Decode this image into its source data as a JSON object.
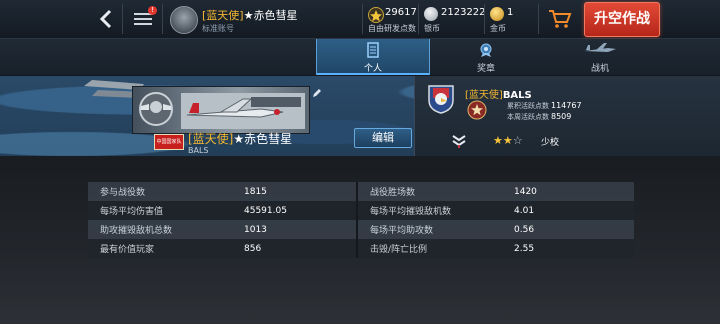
{
  "top_bar": {
    "player_tag": "[蓝天使]",
    "player_name": "★赤色彗星",
    "account_label": "标准账号",
    "menu_badge": "!",
    "resources": [
      {
        "icon": "star-icon",
        "value": "29617",
        "label": "自由研发点数"
      },
      {
        "icon": "silver-coin-icon",
        "value": "2123222",
        "label": "银币"
      },
      {
        "icon": "gold-coin-icon",
        "value": "1",
        "label": "金币"
      }
    ],
    "takeoff_label": "升空作战"
  },
  "tabs": [
    {
      "label": "个人",
      "icon": "personal-doc-icon",
      "active": true
    },
    {
      "label": "奖章",
      "icon": "medal-icon",
      "active": false
    },
    {
      "label": "战机",
      "icon": "plane-icon",
      "active": false
    }
  ],
  "profile": {
    "flag_text": "中国国家队",
    "name_tag": "[蓝天使]",
    "name": "★赤色彗星",
    "clan_short": "BALS",
    "edit_label": "编辑"
  },
  "clan": {
    "tag": "[蓝天使]",
    "name": "BALS",
    "total_activity_label": "累积活跃点数",
    "total_activity_value": "114767",
    "weekly_activity_label": "本周活跃点数",
    "weekly_activity_value": "8509",
    "stars_filled": 2,
    "stars_total": 3,
    "rank_label": "少校"
  },
  "stats": {
    "rows": [
      {
        "left_label": "参与战役数",
        "left_value": "1815",
        "right_label": "战役胜场数",
        "right_value": "1420"
      },
      {
        "left_label": "每场平均伤害值",
        "left_value": "45591.05",
        "right_label": "每场平均摧毁敌机数",
        "right_value": "4.01"
      },
      {
        "left_label": "助攻摧毁敌机总数",
        "left_value": "1013",
        "right_label": "每场平均助攻数",
        "right_value": "0.56"
      },
      {
        "left_label": "最有价值玩家",
        "left_value": "856",
        "right_label": "击毁/阵亡比例",
        "right_value": "2.55"
      }
    ]
  },
  "colors": {
    "accent_gold": "#f2b632",
    "takeoff_red": "#d2362a",
    "tab_active_blue": "#2e5f86"
  }
}
